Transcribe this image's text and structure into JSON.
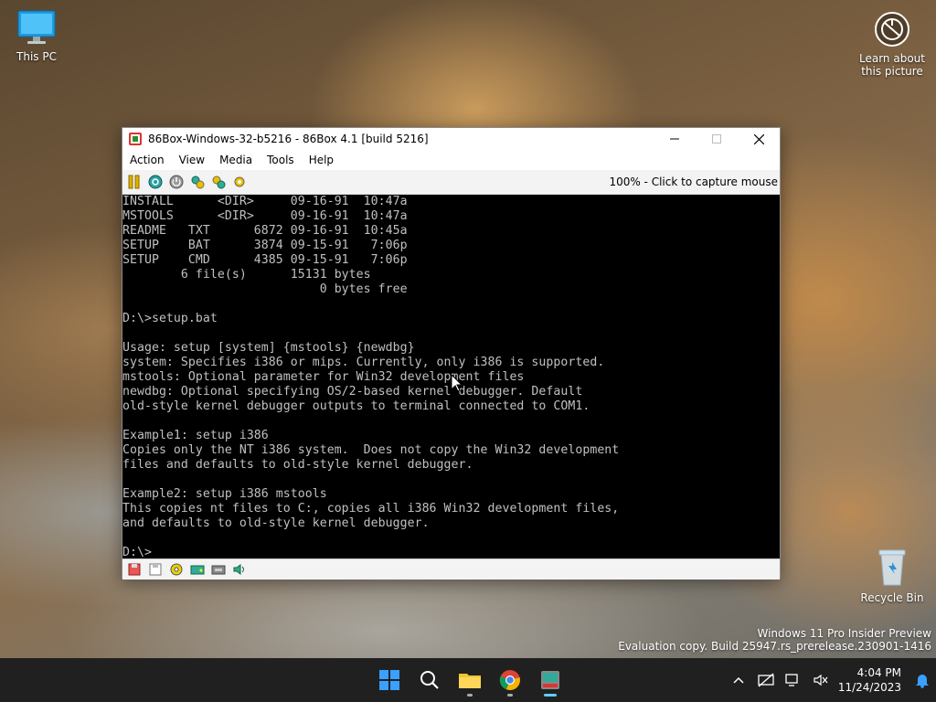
{
  "desktop": {
    "this_pc": "This PC",
    "learn": "Learn about this picture",
    "recycle": "Recycle Bin"
  },
  "window": {
    "title": "86Box-Windows-32-b5216 - 86Box 4.1 [build 5216]",
    "menu": [
      "Action",
      "View",
      "Media",
      "Tools",
      "Help"
    ],
    "status_text": "100% - Click to capture mouse",
    "console_lines": [
      "INSTALL      <DIR>     09-16-91  10:47a",
      "MSTOOLS      <DIR>     09-16-91  10:47a",
      "README   TXT      6872 09-16-91  10:45a",
      "SETUP    BAT      3874 09-15-91   7:06p",
      "SETUP    CMD      4385 09-15-91   7:06p",
      "        6 file(s)      15131 bytes",
      "                           0 bytes free",
      "",
      "D:\\>setup.bat",
      "",
      "Usage: setup [system] {mstools} {newdbg}",
      "system: Specifies i386 or mips. Currently, only i386 is supported.",
      "mstools: Optional parameter for Win32 development files",
      "newdbg: Optional specifying OS/2-based kernel debugger. Default",
      "old-style kernel debugger outputs to terminal connected to COM1.",
      "",
      "Example1: setup i386",
      "Copies only the NT i386 system.  Does not copy the Win32 development",
      "files and defaults to old-style kernel debugger.",
      "",
      "Example2: setup i386 mstools",
      "This copies nt files to C:, copies all i386 Win32 development files,",
      "and defaults to old-style kernel debugger.",
      "",
      "D:\\>"
    ]
  },
  "watermark": {
    "line1": "Windows 11 Pro Insider Preview",
    "line2": "Evaluation copy. Build 25947.rs_prerelease.230901-1416"
  },
  "taskbar": {
    "time": "4:04 PM",
    "date": "11/24/2023"
  },
  "colors": {
    "accent": "#60cdff",
    "console_fg": "#c0c0c0",
    "console_bg": "#000000",
    "taskbar_bg": "#202020"
  }
}
